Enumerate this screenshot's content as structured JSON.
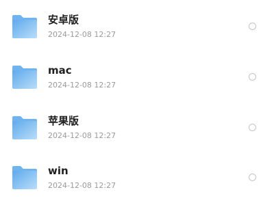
{
  "files": [
    {
      "name": "安卓版",
      "date": "2024-12-08 12:27",
      "icon": "folder-icon",
      "selected": false
    },
    {
      "name": "mac",
      "date": "2024-12-08 12:27",
      "icon": "folder-icon",
      "selected": false
    },
    {
      "name": "苹果版",
      "date": "2024-12-08 12:27",
      "icon": "folder-icon",
      "selected": false
    },
    {
      "name": "win",
      "date": "2024-12-08 12:27",
      "icon": "folder-icon",
      "selected": false
    }
  ],
  "colors": {
    "folder_light": "#b3dcfb",
    "folder_dark": "#5fa9ec",
    "folder_tab": "#6fb3ef",
    "name_text": "#1f1f1f",
    "date_text": "#9a9a9a",
    "radio_border": "#c4c4c4"
  }
}
